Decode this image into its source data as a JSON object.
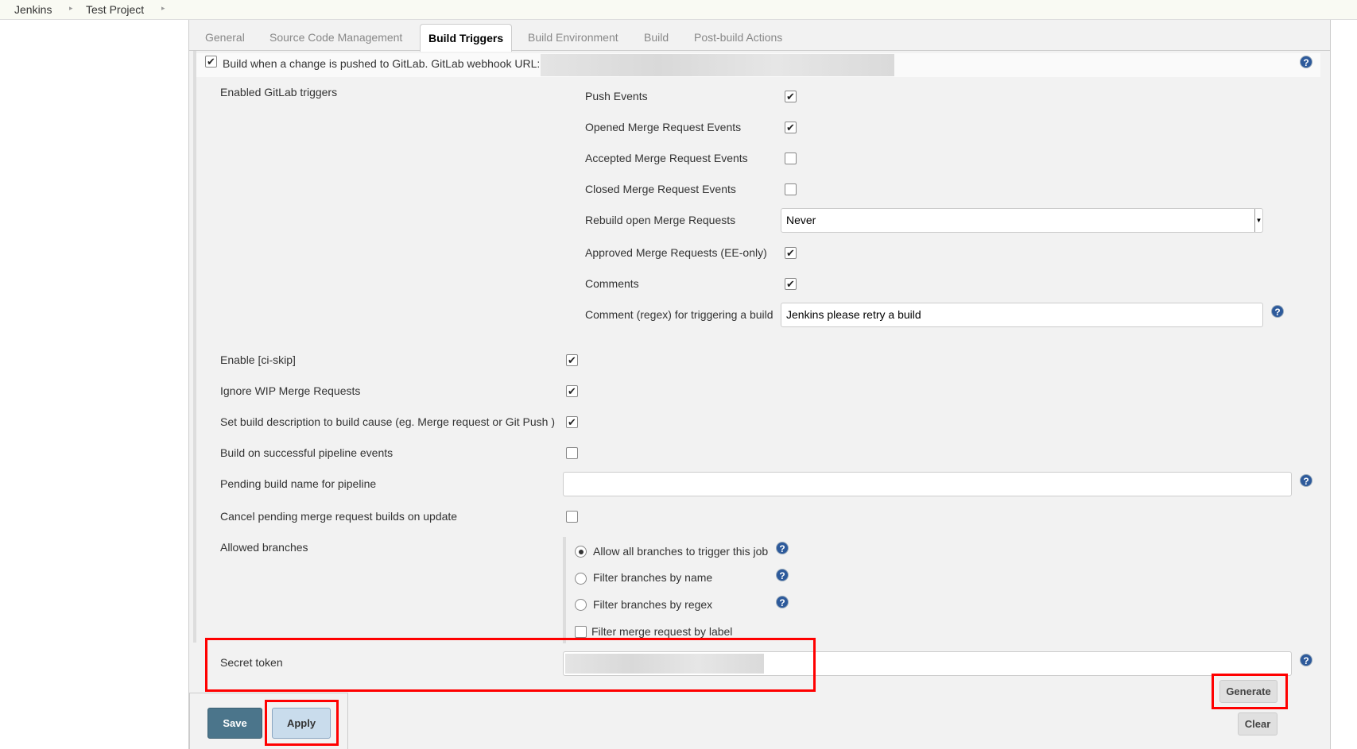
{
  "breadcrumb": [
    "Jenkins",
    "Test Project"
  ],
  "tabs": [
    "General",
    "Source Code Management",
    "Build Triggers",
    "Build Environment",
    "Build",
    "Post-build Actions"
  ],
  "active_tab": "Build Triggers",
  "trigger": {
    "label": "Build when a change is pushed to GitLab. GitLab webhook URL:",
    "checked": true
  },
  "enabled_triggers_label": "Enabled GitLab triggers",
  "events": [
    {
      "label": "Push Events",
      "checked": true
    },
    {
      "label": "Opened Merge Request Events",
      "checked": true
    },
    {
      "label": "Accepted Merge Request Events",
      "checked": false
    },
    {
      "label": "Closed Merge Request Events",
      "checked": false
    }
  ],
  "rebuild": {
    "label": "Rebuild open Merge Requests",
    "value": "Never"
  },
  "events2": [
    {
      "label": "Approved Merge Requests (EE-only)",
      "checked": true
    },
    {
      "label": "Comments",
      "checked": true
    }
  ],
  "comment_regex": {
    "label": "Comment (regex) for triggering a build",
    "value": "Jenkins please retry a build"
  },
  "options": [
    {
      "label": "Enable [ci-skip]",
      "checked": true
    },
    {
      "label": "Ignore WIP Merge Requests",
      "checked": true
    },
    {
      "label": "Set build description to build cause (eg. Merge request or Git Push )",
      "checked": true
    },
    {
      "label": "Build on successful pipeline events",
      "checked": false
    }
  ],
  "pending_build": {
    "label": "Pending build name for pipeline",
    "value": ""
  },
  "cancel_pending": {
    "label": "Cancel pending merge request builds on update",
    "checked": false
  },
  "allowed_branches": {
    "label": "Allowed branches",
    "radios": [
      {
        "label": "Allow all branches to trigger this job",
        "selected": true
      },
      {
        "label": "Filter branches by name",
        "selected": false
      },
      {
        "label": "Filter branches by regex",
        "selected": false
      }
    ],
    "label_filter": {
      "label": "Filter merge request by label",
      "checked": false
    }
  },
  "secret_token": {
    "label": "Secret token"
  },
  "buttons": {
    "save": "Save",
    "apply": "Apply",
    "generate": "Generate",
    "clear": "Clear"
  },
  "help_icon": "?",
  "check_glyph": "✔",
  "colors": {
    "save_bg": "#4b758b",
    "apply_bg": "#c9dcec",
    "highlight": "#ff0000",
    "help": "#2d5a9b"
  }
}
